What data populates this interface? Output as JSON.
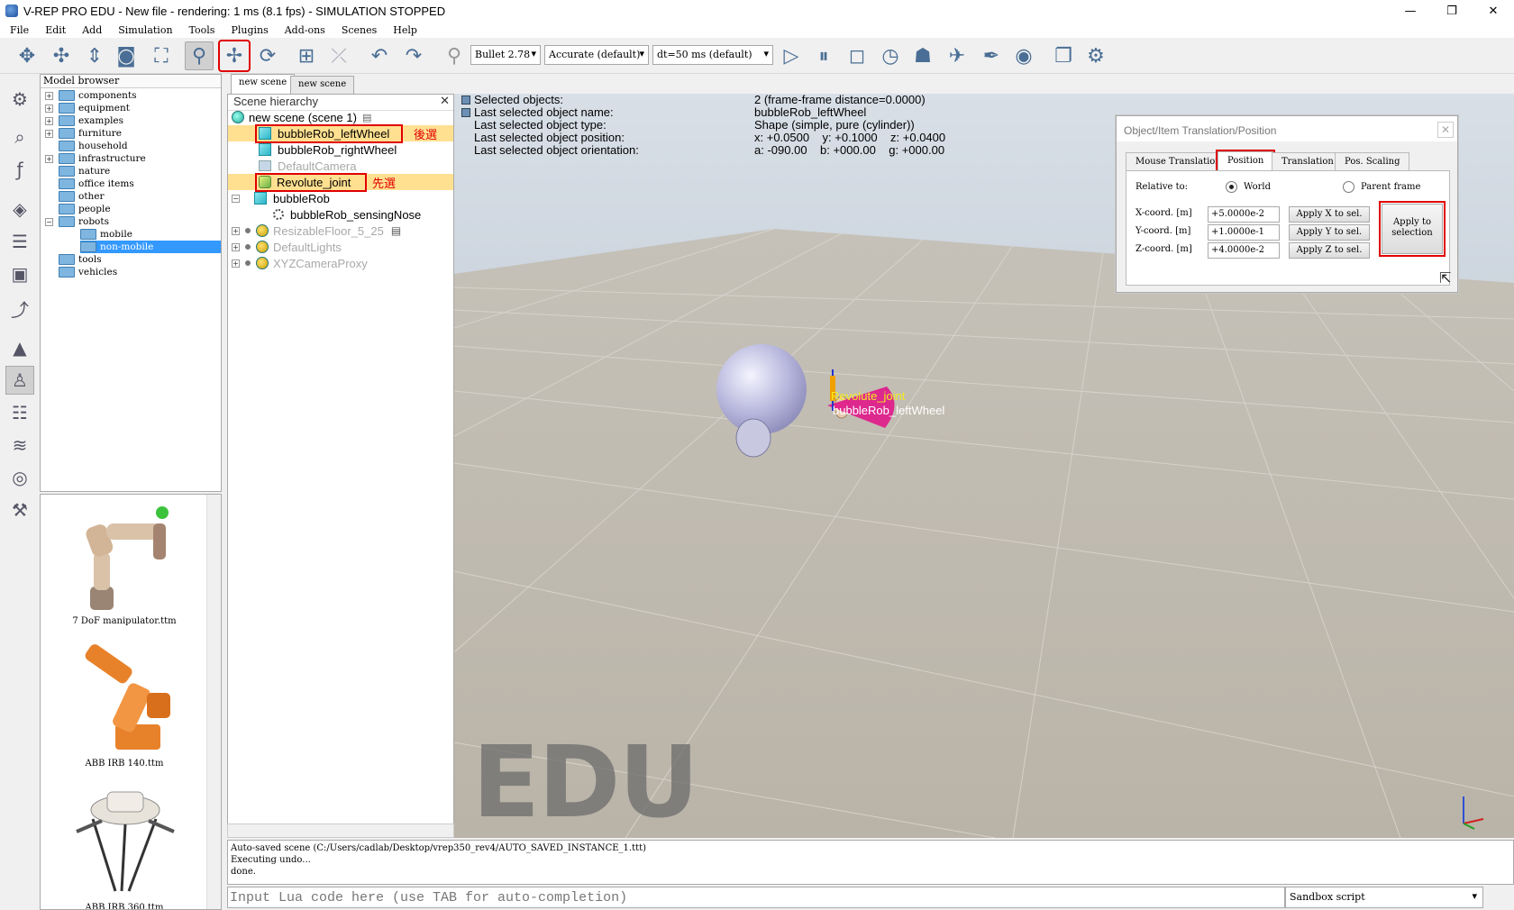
{
  "window": {
    "title": "V-REP PRO EDU - New file - rendering: 1 ms (8.1 fps) - SIMULATION STOPPED",
    "minimize": "—",
    "maximize": "❐",
    "close": "✕"
  },
  "menu": [
    "File",
    "Edit",
    "Add",
    "Simulation",
    "Tools",
    "Plugins",
    "Add-ons",
    "Scenes",
    "Help"
  ],
  "toolbar": {
    "engine": "Bullet 2.78",
    "accuracy": "Accurate (default)",
    "timestep": "dt=50 ms (default)",
    "icons": {
      "camera_pan": "move-arrows-icon",
      "object_shift": "object-shift-icon",
      "play": "play-icon",
      "pause": "pause-icon",
      "stop": "stop-icon"
    }
  },
  "model_browser": {
    "header": "Model browser",
    "folders": [
      {
        "label": "components",
        "expandable": true
      },
      {
        "label": "equipment",
        "expandable": true
      },
      {
        "label": "examples",
        "expandable": true
      },
      {
        "label": "furniture",
        "expandable": true
      },
      {
        "label": "household",
        "expandable": false
      },
      {
        "label": "infrastructure",
        "expandable": true
      },
      {
        "label": "nature",
        "expandable": false
      },
      {
        "label": "office items",
        "expandable": false
      },
      {
        "label": "other",
        "expandable": false
      },
      {
        "label": "people",
        "expandable": false
      },
      {
        "label": "robots",
        "expandable": true
      }
    ],
    "subfolders": [
      "mobile",
      "non-mobile"
    ],
    "tail_folders": [
      "tools",
      "vehicles"
    ],
    "thumbnails": [
      "7 DoF manipulator.ttm",
      "ABB IRB 140.ttm",
      "ABB IRB 360.ttm"
    ]
  },
  "scene_tabs": [
    "new scene",
    "new scene"
  ],
  "hierarchy": {
    "header": "Scene hierarchy",
    "root": "new scene (scene 1)",
    "items": [
      "bubbleRob_leftWheel",
      "bubbleRob_rightWheel",
      "DefaultCamera",
      "Revolute_joint",
      "bubbleRob",
      "bubbleRob_sensingNose",
      "ResizableFloor_5_25",
      "DefaultLights",
      "XYZCameraProxy"
    ],
    "annotation_after": "後選",
    "annotation_before": "先選"
  },
  "info": {
    "labels": [
      "Selected objects:",
      "Last selected object name:",
      "Last selected object type:",
      "Last selected object position:",
      "Last selected object orientation:"
    ],
    "values": [
      "2 (frame-frame distance=0.0000)",
      "bubbleRob_leftWheel",
      "Shape (simple, pure (cylinder))",
      "x: +0.0500    y: +0.1000    z: +0.0400",
      "a: -090.00    b: +000.00    g: +000.00"
    ]
  },
  "scene": {
    "watermark": "EDU",
    "label_joint": "Revolute_joint",
    "label_wheel": "bubbleRob_leftWheel"
  },
  "dialog": {
    "title": "Object/Item Translation/Position",
    "tabs": [
      "Mouse Translation",
      "Position",
      "Translation",
      "Pos. Scaling"
    ],
    "relative_to": "Relative to:",
    "world": "World",
    "parent_frame": "Parent frame",
    "x_label": "X-coord. [m]",
    "y_label": "Y-coord. [m]",
    "z_label": "Z-coord. [m]",
    "x_value": "+5.0000e-2",
    "y_value": "+1.0000e-1",
    "z_value": "+4.0000e-2",
    "apply_x": "Apply X to sel.",
    "apply_y": "Apply Y to sel.",
    "apply_z": "Apply Z to sel.",
    "apply_sel_1": "Apply to",
    "apply_sel_2": "selection"
  },
  "console": {
    "lines": [
      "Auto-saved scene (C:/Users/cadlab/Desktop/vrep350_rev4/AUTO_SAVED_INSTANCE_1.ttt)",
      "Executing undo...",
      "done."
    ]
  },
  "lua": {
    "placeholder": "Input Lua code here (use TAB for auto-completion)",
    "script_mode": "Sandbox script"
  }
}
